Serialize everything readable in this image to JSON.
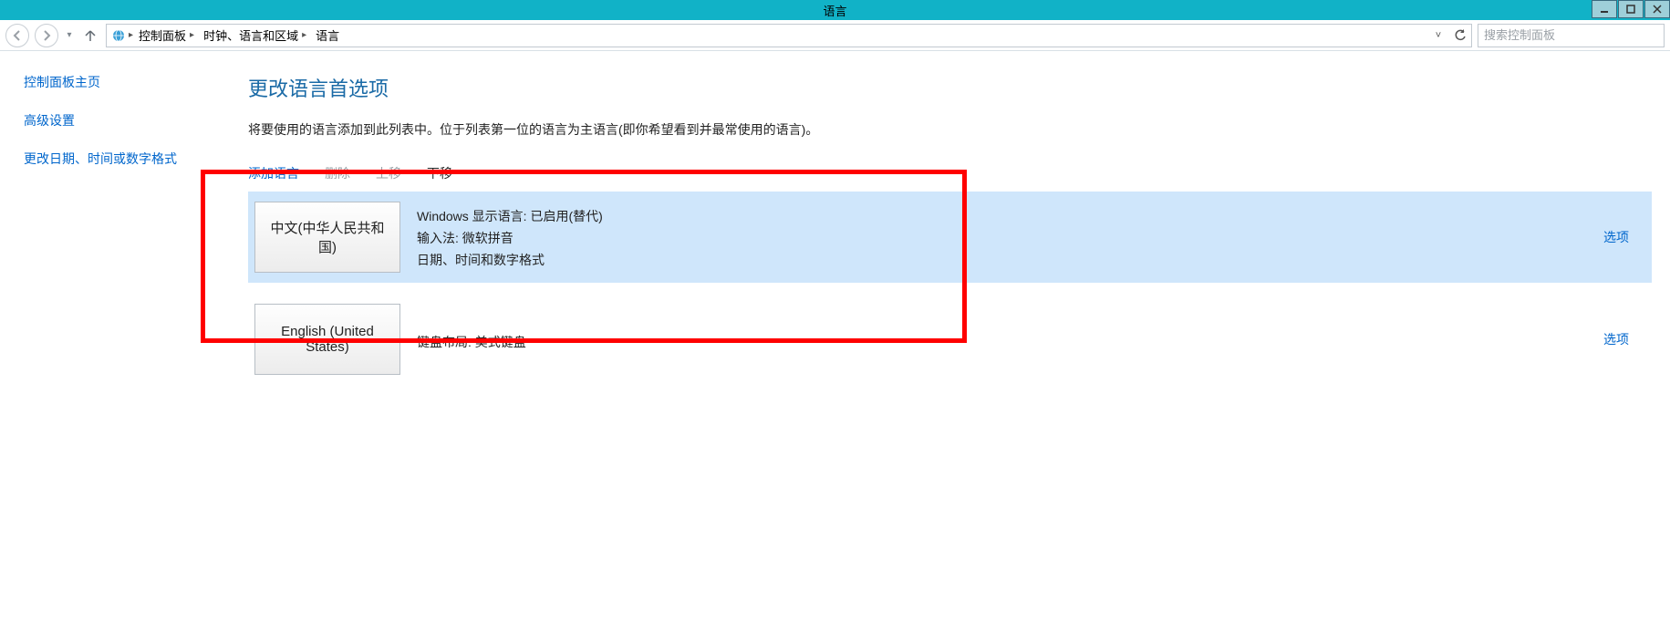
{
  "window": {
    "title": "语言"
  },
  "breadcrumb": {
    "items": [
      "控制面板",
      "时钟、语言和区域",
      "语言"
    ]
  },
  "search": {
    "placeholder": "搜索控制面板"
  },
  "sidebar": {
    "links": [
      "控制面板主页",
      "高级设置",
      "更改日期、时间或数字格式"
    ]
  },
  "page": {
    "title": "更改语言首选项",
    "description": "将要使用的语言添加到此列表中。位于列表第一位的语言为主语言(即你希望看到并最常使用的语言)。"
  },
  "actions": {
    "add": "添加语言",
    "remove": "删除",
    "moveUp": "上移",
    "moveDown": "下移"
  },
  "languages": [
    {
      "name": "中文(中华人民共和国)",
      "details": [
        "Windows 显示语言: 已启用(替代)",
        "输入法: 微软拼音",
        "日期、时间和数字格式"
      ],
      "optionsLabel": "选项",
      "selected": true
    },
    {
      "name": "English (United States)",
      "details": [
        "键盘布局: 美式键盘"
      ],
      "optionsLabel": "选项",
      "selected": false
    }
  ]
}
